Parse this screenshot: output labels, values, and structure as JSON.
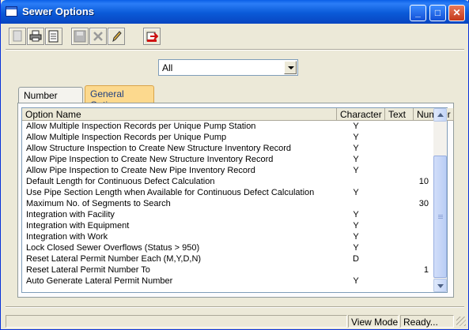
{
  "window": {
    "title": "Sewer Options"
  },
  "titlebar_buttons": [
    {
      "name": "minimize",
      "glyph": "_"
    },
    {
      "name": "maximize",
      "glyph": "□"
    },
    {
      "name": "close",
      "glyph": "✕"
    }
  ],
  "toolbar_icons": [
    "blank-doc-icon",
    "print-icon",
    "print-preview-icon",
    "save-icon",
    "delete-icon",
    "edit-icon",
    "exit-icon"
  ],
  "filter": {
    "selected": "All"
  },
  "tabs": [
    {
      "label": "Number Format",
      "active": false
    },
    {
      "label": "General Options",
      "active": true
    }
  ],
  "grid": {
    "columns": [
      "Option Name",
      "Character",
      "Text",
      "Number"
    ],
    "rows": [
      {
        "name": "Allow Multiple Inspection Records per Unique Pump Station",
        "character": "Y",
        "text": "",
        "number": ""
      },
      {
        "name": "Allow Multiple Inspection Records per Unique Pump",
        "character": "Y",
        "text": "",
        "number": ""
      },
      {
        "name": "Allow Structure Inspection to Create New Structure Inventory Record",
        "character": "Y",
        "text": "",
        "number": ""
      },
      {
        "name": "Allow Pipe Inspection to Create New Structure Inventory Record",
        "character": "Y",
        "text": "",
        "number": ""
      },
      {
        "name": "Allow Pipe Inspection to Create New Pipe Inventory Record",
        "character": "Y",
        "text": "",
        "number": ""
      },
      {
        "name": "Default Length for Continuous Defect Calculation",
        "character": "",
        "text": "",
        "number": "10"
      },
      {
        "name": "Use Pipe Section Length when Available for Continuous Defect Calculation",
        "character": "Y",
        "text": "",
        "number": ""
      },
      {
        "name": "Maximum No. of Segments to Search",
        "character": "",
        "text": "",
        "number": "30"
      },
      {
        "name": "Integration with Facility",
        "character": "Y",
        "text": "",
        "number": ""
      },
      {
        "name": "Integration with Equipment",
        "character": "Y",
        "text": "",
        "number": ""
      },
      {
        "name": "Integration with Work",
        "character": "Y",
        "text": "",
        "number": ""
      },
      {
        "name": "Lock Closed Sewer Overflows (Status > 950)",
        "character": "Y",
        "text": "",
        "number": ""
      },
      {
        "name": "Reset Lateral Permit Number Each (M,Y,D,N)",
        "character": "D",
        "text": "",
        "number": ""
      },
      {
        "name": "Reset Lateral Permit Number To",
        "character": "",
        "text": "",
        "number": "1"
      },
      {
        "name": "Auto Generate Lateral Permit Number",
        "character": "Y",
        "text": "",
        "number": ""
      }
    ]
  },
  "status": {
    "mode": "View Mode",
    "message": "Ready..."
  }
}
